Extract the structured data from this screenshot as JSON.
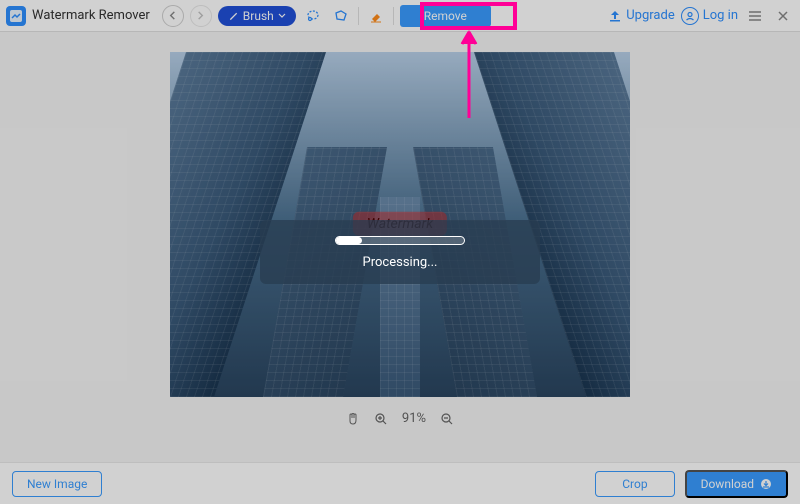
{
  "app": {
    "title": "Watermark Remover"
  },
  "toolbar": {
    "brush_label": "Brush",
    "remove_label": "Remove",
    "upgrade_label": "Upgrade",
    "login_label": "Log in"
  },
  "canvas": {
    "watermark_text": "Watermark",
    "processing_text": "Processing...",
    "zoom_percent": "91%"
  },
  "bottom": {
    "new_image_label": "New Image",
    "crop_label": "Crop",
    "download_label": "Download"
  }
}
